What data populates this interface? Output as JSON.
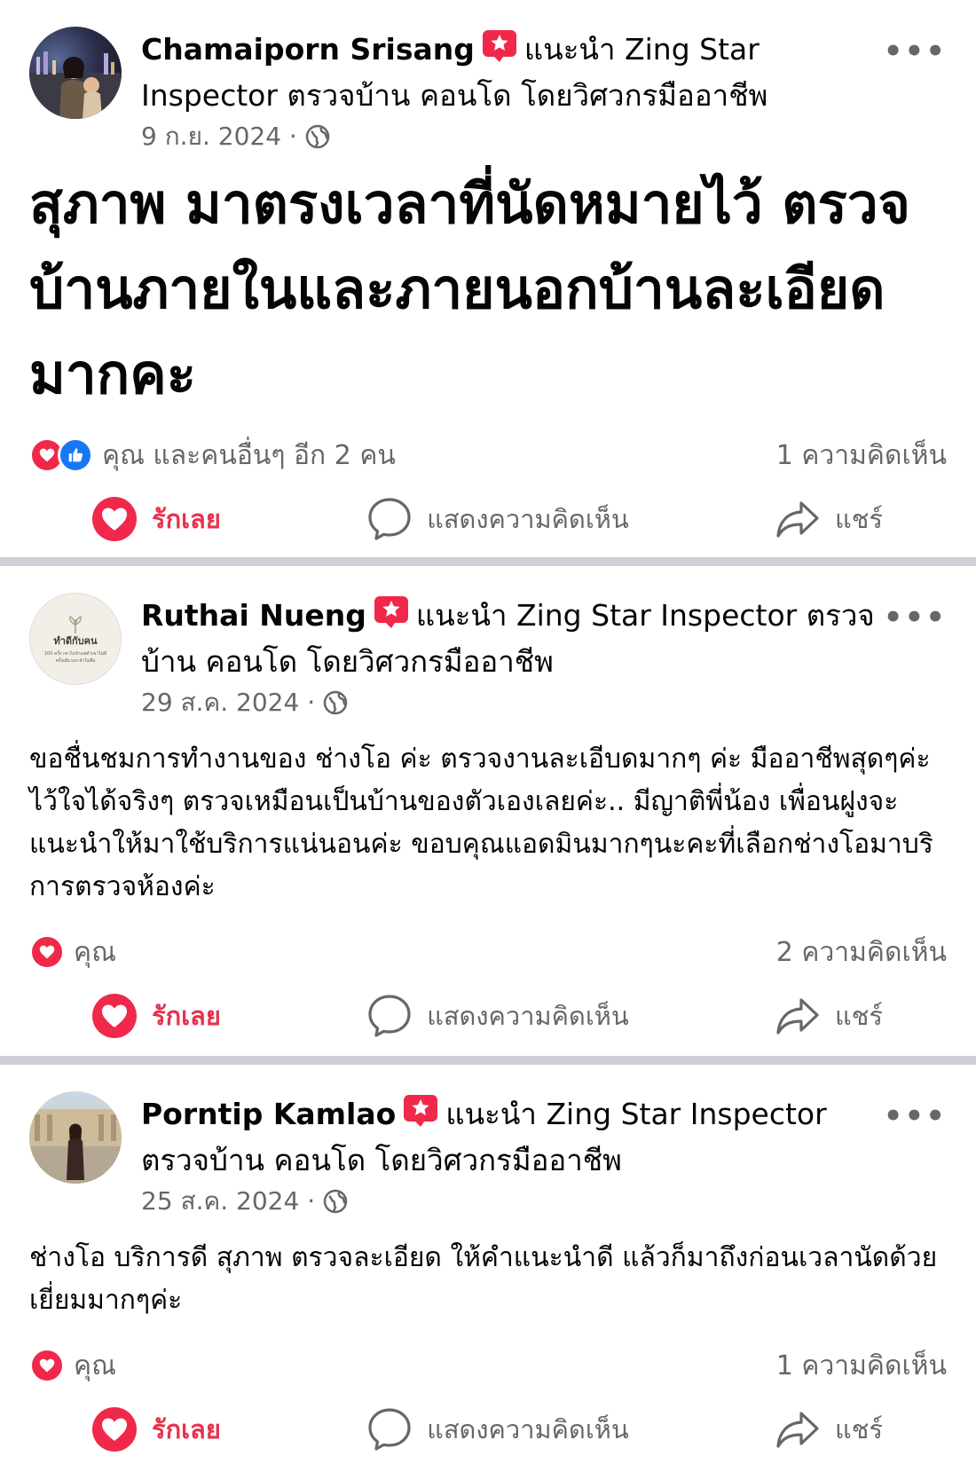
{
  "posts": [
    {
      "author": "Chamaiporn Srisang",
      "recommend_text": "แนะนำ Zing Star Inspector ตรวจบ้าน คอนโด โดยวิศวกรมืออาชีพ",
      "date": "9 ก.ย. 2024 ·",
      "text": "สุภาพ มาตรงเวลาที่นัดหมายไว้ ตรวจบ้านภายในและภายนอกบ้านละเอียดมากคะ",
      "reactions_text": "คุณ และคนอื่นๆ อีก 2 คน",
      "comments": "1 ความคิดเห็น"
    },
    {
      "author": "Ruthai Nueng",
      "recommend_text": "แนะนำ Zing Star Inspector ตรวจบ้าน คอนโด โดยวิศวกรมืออาชีพ",
      "date": "29 ส.ค. 2024 ·",
      "text": "ขอชื่นชมการทำงานของ ช่างโอ ค่ะ ตรวจงานละเอีบดมากๆ ค่ะ มืออาชีพสุดๆค่ะ ไว้ใจได้จริงๆ ตรวจเหมือนเป็นบ้านของตัวเองเลยค่ะ.. มีญาติพี่น้อง เพื่อนฝูงจะแนะนำให้มาใช้บริการแน่นอนค่ะ ขอบคุณแอดมินมากๆนะคะที่เลือกช่างโอมาบริการตรวจห้องค่ะ",
      "reactions_text": "คุณ",
      "comments": "2 ความคิดเห็น",
      "avatar_text_1": "ทำดีกับคน",
      "avatar_text_2": "100 ครั้ง เขาไม่จำแต่ทำเขาไม่ดี",
      "avatar_text_3": "ครั้งเดียวเขาจำไม่ลืม"
    },
    {
      "author": "Porntip Kamlao",
      "recommend_text": "แนะนำ Zing Star Inspector ตรวจบ้าน คอนโด โดยวิศวกรมืออาชีพ",
      "date": "25 ส.ค. 2024 ·",
      "text": "ช่างโอ บริการดี สุภาพ ตรวจละเอียด ให้คำแนะนำดี แล้วก็มาถึงก่อนเวลานัดด้วย เยี่ยมมากๆค่ะ",
      "reactions_text": "คุณ",
      "comments": "1 ความคิดเห็น"
    }
  ],
  "actions": {
    "love": "รักเลย",
    "comment": "แสดงความคิดเห็น",
    "share": "แชร์"
  },
  "more_label": "•••",
  "colors": {
    "love": "#f0284a",
    "like": "#1877f2",
    "muted": "#65676b",
    "divider": "#cdd0d4"
  }
}
